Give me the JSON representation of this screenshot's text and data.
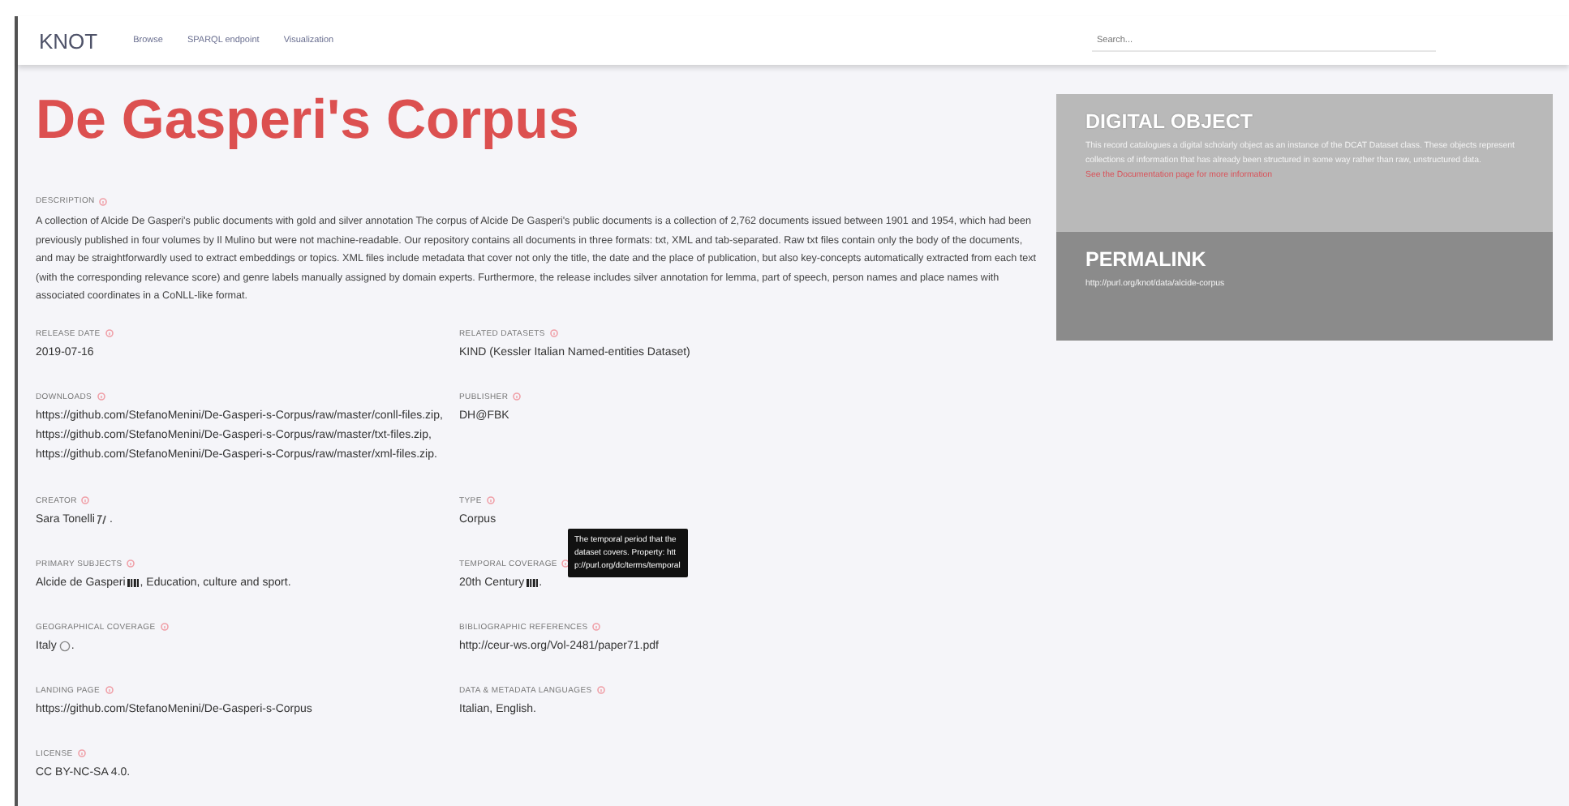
{
  "header": {
    "logo": "KNOT",
    "nav": [
      {
        "label": "Browse"
      },
      {
        "label": "SPARQL endpoint"
      },
      {
        "label": "Visualization"
      }
    ],
    "search": {
      "placeholder": "Search..."
    }
  },
  "title": "De Gasperi's Corpus",
  "description": {
    "label": "DESCRIPTION",
    "text": "A collection of Alcide De Gasperi's public documents with gold and silver annotation The corpus of Alcide De Gasperi's public documents is a collection of 2,762 documents issued between 1901 and 1954, which had been previously published in four volumes by Il Mulino but were not machine-readable. Our repository contains all documents in three formats: txt, XML and tab-separated. Raw txt files contain only the body of the documents, and may be straightforwardly used to extract embeddings or topics. XML files include metadata that cover not only the title, the date and the place of publication, but also key-concepts automatically extracted from each text (with the corresponding relevance score) and genre labels manually assigned by domain experts. Furthermore, the release includes silver annotation for lemma, part of speech, person names and place names with associated coordinates in a CoNLL-like format."
  },
  "field_rows": [
    [
      {
        "label": "RELEASE DATE",
        "values": [
          "2019-07-16"
        ],
        "kind": "plain"
      },
      {
        "label": "RELATED DATASETS",
        "values": [
          "KIND (Kessler Italian Named-entities Dataset)"
        ],
        "kind": "plain"
      }
    ],
    [
      {
        "label": "DOWNLOADS",
        "values": [
          "https://github.com/StefanoMenini/De-Gasperi-s-Corpus/raw/master/conll-files.zip,",
          "https://github.com/StefanoMenini/De-Gasperi-s-Corpus/raw/master/txt-files.zip,",
          "https://github.com/StefanoMenini/De-Gasperi-s-Corpus/raw/master/xml-files.zip."
        ],
        "kind": "plain"
      },
      {
        "label": "PUBLISHER",
        "values": [
          "DH@FBK"
        ],
        "kind": "plain"
      }
    ],
    [
      {
        "label": "CREATOR",
        "values": [
          "Sara Tonelli"
        ],
        "kind": "person",
        "suffix": "."
      },
      {
        "label": "TYPE",
        "values": [
          "Corpus"
        ],
        "kind": "plain"
      }
    ],
    [
      {
        "label": "PRIMARY SUBJECTS",
        "values": [
          "Alcide de Gasperi"
        ],
        "kind": "entity",
        "suffix": ", Education, culture and sport."
      },
      {
        "label": "TEMPORAL COVERAGE",
        "values": [
          "20th Century"
        ],
        "kind": "entity",
        "suffix": ".",
        "tooltip": "The temporal period that the dataset covers. Property: http://purl.org/dc/terms/temporal"
      }
    ],
    [
      {
        "label": "GEOGRAPHICAL COVERAGE",
        "values": [
          "Italy"
        ],
        "kind": "place",
        "suffix": "."
      },
      {
        "label": "BIBLIOGRAPHIC REFERENCES",
        "values": [
          "http://ceur-ws.org/Vol-2481/paper71.pdf"
        ],
        "kind": "plain"
      }
    ],
    [
      {
        "label": "LANDING PAGE",
        "values": [
          "https://github.com/StefanoMenini/De-Gasperi-s-Corpus"
        ],
        "kind": "plain"
      },
      {
        "label": "DATA & METADATA LANGUAGES",
        "values": [
          "Italian, English."
        ],
        "kind": "plain"
      }
    ],
    [
      {
        "label": "LICENSE",
        "values": [
          "CC BY-NC-SA 4.0."
        ],
        "kind": "plain"
      }
    ]
  ],
  "panels": [
    {
      "kind": "info",
      "title": "DIGITAL OBJECT",
      "text": "This record catalogues a digital scholarly object as an instance of the DCAT Dataset class. These objects represent collections of information that has already been structured in some way rather than raw, unstructured data.",
      "link": "See the Documentation page for more information"
    },
    {
      "kind": "permalink",
      "title": "PERMALINK",
      "text": "http://purl.org/knot/data/alcide-corpus"
    }
  ]
}
